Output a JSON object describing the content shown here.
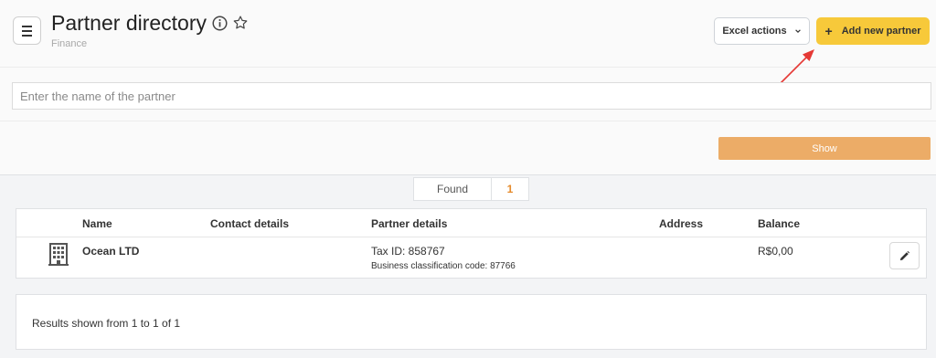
{
  "header": {
    "title": "Partner directory",
    "subtitle": "Finance",
    "excel_label": "Excel actions",
    "add_label": "Add new partner",
    "add_icon": "+"
  },
  "search": {
    "placeholder": "Enter the name of the partner",
    "value": ""
  },
  "filter": {
    "show_label": "Show"
  },
  "found": {
    "label": "Found",
    "count": "1"
  },
  "table": {
    "columns": [
      "Name",
      "Contact details",
      "Partner details",
      "Address",
      "Balance"
    ],
    "rows": [
      {
        "name": "Ocean LTD",
        "contact": "",
        "tax_id": "Tax ID: 858767",
        "classification": "Business classification code: 87766",
        "address": "",
        "balance": "R$0,00"
      }
    ]
  },
  "footer": {
    "results_text": "Results shown from 1 to 1 of 1"
  },
  "colors": {
    "accent_yellow": "#f7c93a",
    "show_orange": "#ecac67",
    "count_orange": "#e58a2b",
    "annotation_red": "#e53935"
  },
  "icons": [
    "menu-icon",
    "info-icon",
    "star-icon",
    "chevron-down-icon",
    "plus-icon",
    "building-icon",
    "pencil-icon"
  ]
}
